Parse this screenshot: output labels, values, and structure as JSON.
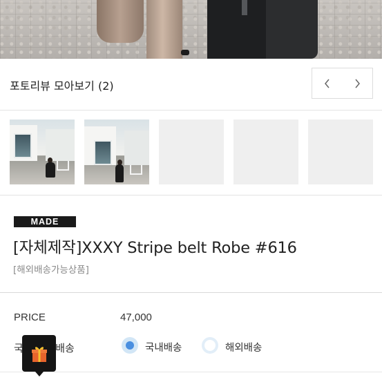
{
  "photo_review": {
    "title": "포토리뷰 모아보기",
    "count": "(2)",
    "prev_icon": "chevron-left-icon",
    "next_icon": "chevron-right-icon"
  },
  "thumbnails": [
    {
      "state": "photo"
    },
    {
      "state": "photo"
    },
    {
      "state": "empty"
    },
    {
      "state": "empty"
    },
    {
      "state": "empty"
    }
  ],
  "product": {
    "badge": "MADE",
    "name": "[자체제작]XXXY Stripe belt Robe #616",
    "tag": "[해외배송가능상품]"
  },
  "info": {
    "price_label": "PRICE",
    "price_value": "47,000",
    "shipping_label": "국내·해외배송",
    "shipping_options": [
      {
        "label": "국내배송",
        "selected": true
      },
      {
        "label": "해외배송",
        "selected": false
      }
    ]
  },
  "gift_button": {
    "icon": "gift-icon"
  },
  "colors": {
    "radio_accent": "#4a8fe0",
    "badge_bg": "#1a1a1a"
  }
}
